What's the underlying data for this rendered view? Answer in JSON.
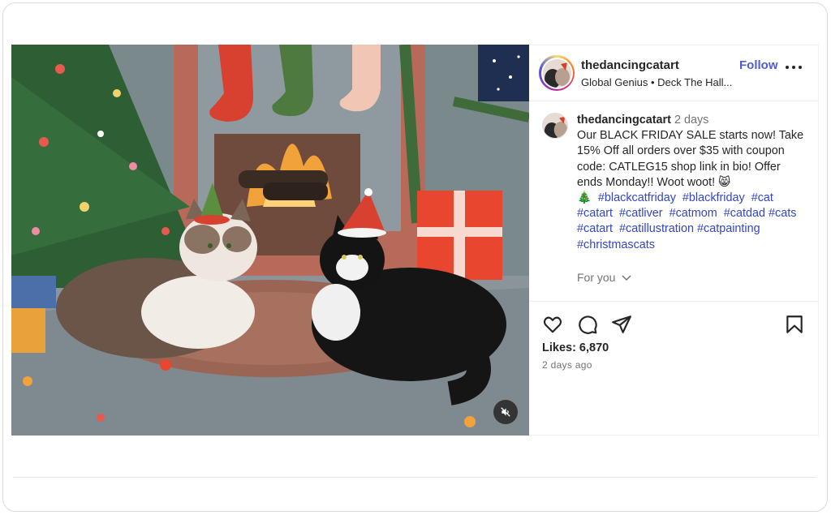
{
  "post": {
    "username": "thedancingcatart",
    "subtitle": "Global Genius • Deck The Hall...",
    "follow_label": "Follow",
    "caption_time": "2 days",
    "caption_text": "Our BLACK FRIDAY SALE starts now! Take 15% Off all orders over $35 with coupon code: CATLEG15 shop link in bio! Offer ends Monday!! Woot woot! 😸",
    "caption_emoji_line": "🎄",
    "hashtags": [
      "#blackcatfriday",
      "#blackfriday",
      "#cat",
      "#catart",
      "#catliver",
      "#catmom",
      "#catdad",
      "#cats",
      "#catart",
      "#catillustration",
      "#catpainting",
      "#christmascats"
    ],
    "for_you_label": "For you",
    "likes_label": "Likes: 6,870",
    "time_ago": "2 days ago"
  },
  "icons": {
    "like": "heart-icon",
    "comment": "comment-icon",
    "share": "paper-plane-icon",
    "save": "bookmark-icon",
    "more": "more-horizontal-icon",
    "mute": "muted-speaker-icon",
    "chevron": "chevron-down-icon"
  },
  "colors": {
    "link": "#4f5bd5",
    "hashtag": "#3346c6",
    "muted": "#737373",
    "text": "#262626"
  }
}
